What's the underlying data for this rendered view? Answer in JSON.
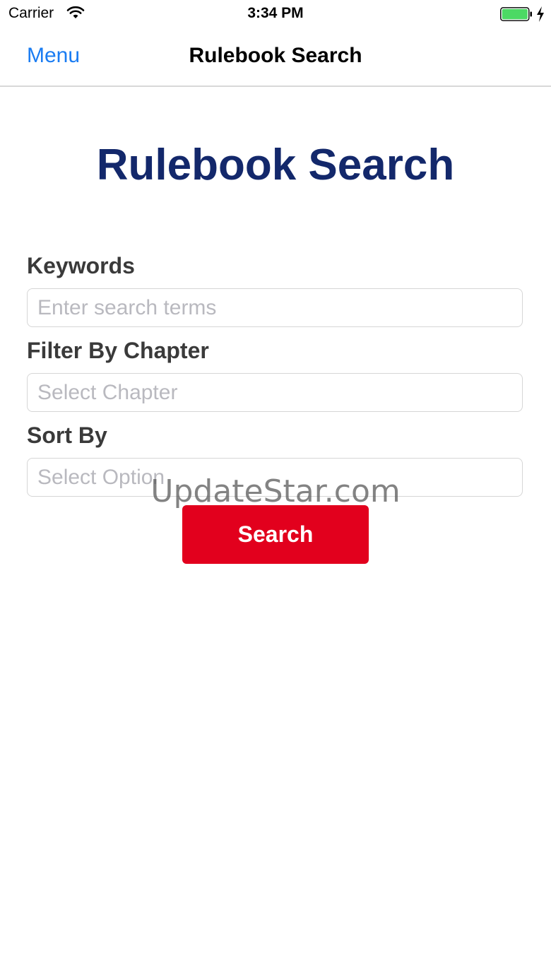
{
  "status_bar": {
    "carrier": "Carrier",
    "time": "3:34 PM",
    "icons": [
      "wifi-icon",
      "battery-icon",
      "charging-bolt-icon"
    ],
    "battery_color": "#4cd964"
  },
  "nav": {
    "menu_label": "Menu",
    "title": "Rulebook Search",
    "menu_color": "#1a7cf2"
  },
  "page": {
    "title": "Rulebook Search",
    "title_color": "#13286b"
  },
  "form": {
    "keywords": {
      "label": "Keywords",
      "value": "",
      "placeholder": "Enter search terms"
    },
    "chapter": {
      "label": "Filter By Chapter",
      "placeholder": "Select Chapter"
    },
    "sort": {
      "label": "Sort By",
      "placeholder": "Select Option"
    },
    "search_button": {
      "label": "Search",
      "color": "#e2001d"
    }
  },
  "watermark": "UpdateStar.com"
}
